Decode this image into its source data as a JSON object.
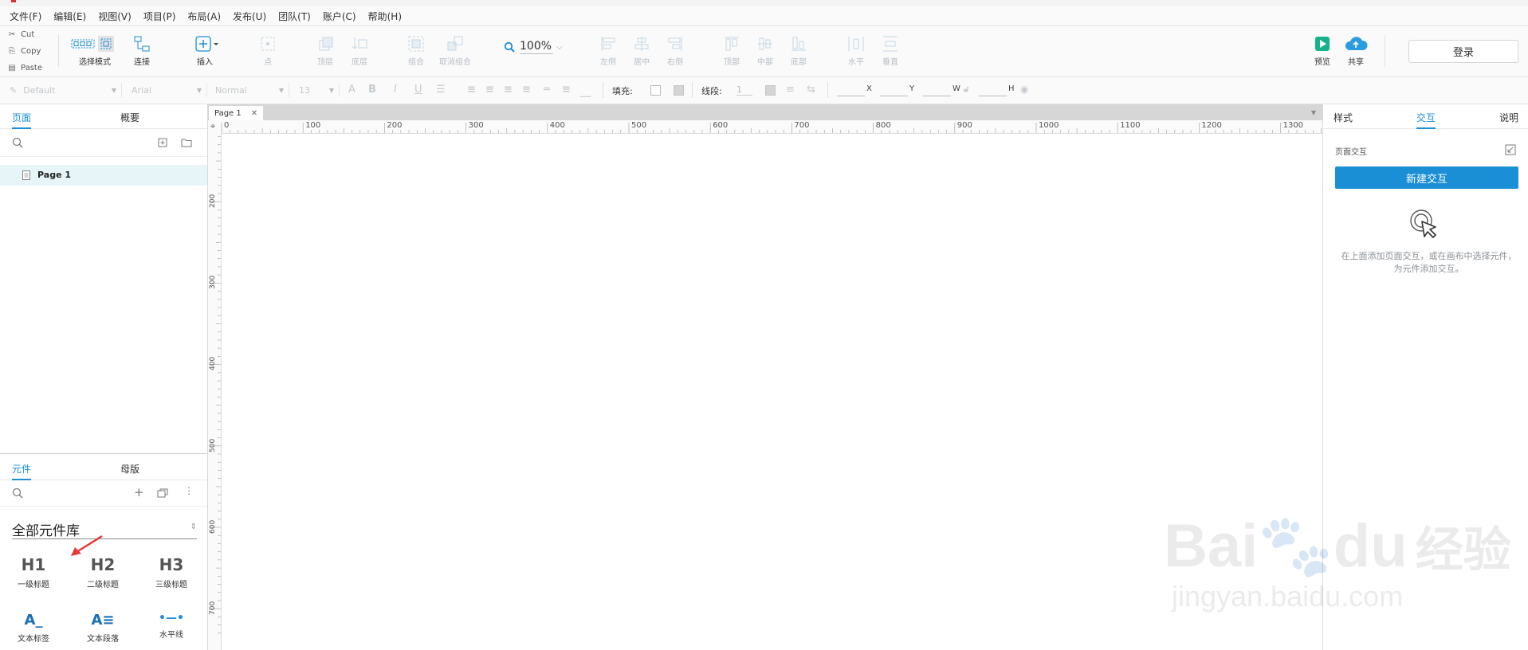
{
  "menu": [
    "文件(F)",
    "编辑(E)",
    "视图(V)",
    "项目(P)",
    "布局(A)",
    "发布(U)",
    "团队(T)",
    "账户(C)",
    "帮助(H)"
  ],
  "clipboard": {
    "cut": "Cut",
    "copy": "Copy",
    "paste": "Paste"
  },
  "toolbar": {
    "select_mode": "选择模式",
    "connect": "连接",
    "insert": "插入",
    "point": "点",
    "top_layer": "顶层",
    "bottom_layer": "底层",
    "group": "组合",
    "ungroup": "取消组合",
    "zoom": "100%",
    "align_left": "左侧",
    "align_center": "居中",
    "align_right": "右侧",
    "align_top": "顶部",
    "align_middle": "中部",
    "align_bottom": "底部",
    "dist_horizontal": "水平",
    "dist_vertical": "垂直",
    "preview": "预览",
    "share": "共享",
    "login": "登录"
  },
  "format": {
    "style": "Default",
    "font": "Arial",
    "weight": "Normal",
    "size": "13",
    "fill_label": "填充:",
    "line_label": "线段:",
    "line_value": "1",
    "x": "X",
    "y": "Y",
    "w": "W",
    "h": "H"
  },
  "left": {
    "tab_pages": "页面",
    "tab_outline": "概要",
    "page_item": "Page 1",
    "tab_widgets": "元件",
    "tab_masters": "母版",
    "library": "全部元件库",
    "widgets": [
      {
        "icon": "H1",
        "label": "一级标题"
      },
      {
        "icon": "H2",
        "label": "二级标题"
      },
      {
        "icon": "H3",
        "label": "三级标题"
      },
      {
        "icon": "A_",
        "label": "文本标签"
      },
      {
        "icon": "A≡",
        "label": "文本段落"
      },
      {
        "icon": "•—•",
        "label": "水平线"
      }
    ]
  },
  "canvas": {
    "page_tab": "Page 1",
    "ruler_h": [
      "0",
      "100",
      "200",
      "300",
      "400",
      "500",
      "600",
      "700",
      "800",
      "900",
      "1000",
      "1100",
      "1200",
      "1300"
    ],
    "ruler_v": [
      "200",
      "300",
      "400",
      "500",
      "600",
      "700"
    ]
  },
  "right": {
    "tab_style": "样式",
    "tab_interaction": "交互",
    "tab_notes": "说明",
    "page_interaction": "页面交互",
    "new_interaction": "新建交互",
    "hint": "在上面添加页面交互，或在画布中选择元件，为元件添加交互。"
  },
  "watermark": {
    "brand": "Bai",
    "brand2": "du",
    "product": "经验",
    "url": "jingyan.baidu.com"
  },
  "colors": {
    "accent": "#1a8fd6",
    "preview": "#16b38a",
    "share": "#2c9be0",
    "annotation": "#e53935"
  }
}
